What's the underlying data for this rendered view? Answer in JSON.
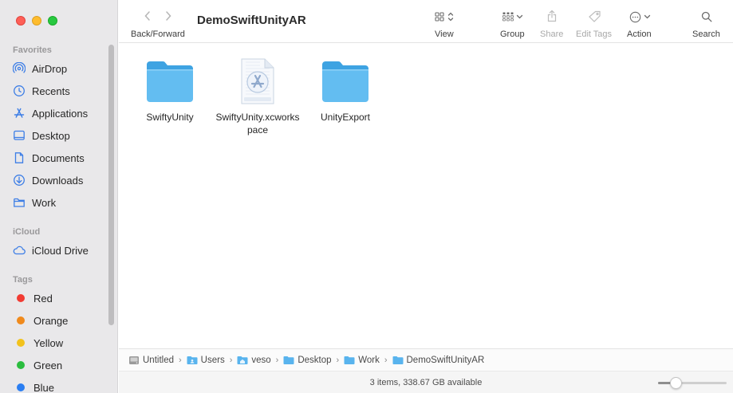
{
  "window": {
    "title": "DemoSwiftUnityAR"
  },
  "toolbar": {
    "back_forward_label": "Back/Forward",
    "view_label": "View",
    "group_label": "Group",
    "share_label": "Share",
    "edit_tags_label": "Edit Tags",
    "action_label": "Action",
    "search_label": "Search"
  },
  "sidebar": {
    "favorites_title": "Favorites",
    "favorites": [
      {
        "label": "AirDrop",
        "icon": "airdrop-icon"
      },
      {
        "label": "Recents",
        "icon": "clock-icon"
      },
      {
        "label": "Applications",
        "icon": "applications-icon"
      },
      {
        "label": "Desktop",
        "icon": "desktop-icon"
      },
      {
        "label": "Documents",
        "icon": "document-icon"
      },
      {
        "label": "Downloads",
        "icon": "download-icon"
      },
      {
        "label": "Work",
        "icon": "folder-icon"
      }
    ],
    "icloud_title": "iCloud",
    "icloud": [
      {
        "label": "iCloud Drive",
        "icon": "cloud-icon"
      }
    ],
    "tags_title": "Tags",
    "tags": [
      {
        "label": "Red",
        "color": "#f23b33"
      },
      {
        "label": "Orange",
        "color": "#f08a1c"
      },
      {
        "label": "Yellow",
        "color": "#f2c21c"
      },
      {
        "label": "Green",
        "color": "#2bbd3f"
      },
      {
        "label": "Blue",
        "color": "#2a7ef2"
      }
    ]
  },
  "files": [
    {
      "name": "SwiftyUnity",
      "kind": "folder"
    },
    {
      "name": "SwiftyUnity.xcworkspace",
      "kind": "xcworkspace"
    },
    {
      "name": "UnityExport",
      "kind": "folder"
    }
  ],
  "pathbar": {
    "crumbs": [
      {
        "label": "Untitled",
        "icon": "disk-icon"
      },
      {
        "label": "Users",
        "icon": "folder-icon"
      },
      {
        "label": "veso",
        "icon": "home-icon"
      },
      {
        "label": "Desktop",
        "icon": "folder-icon"
      },
      {
        "label": "Work",
        "icon": "folder-icon"
      },
      {
        "label": "DemoSwiftUnityAR",
        "icon": "folder-icon"
      }
    ]
  },
  "status": {
    "text": "3 items, 338.67 GB available",
    "icon_size_level": 0.25
  },
  "colors": {
    "accent": "#3d7ee6",
    "folder": "#5ab8f0"
  }
}
